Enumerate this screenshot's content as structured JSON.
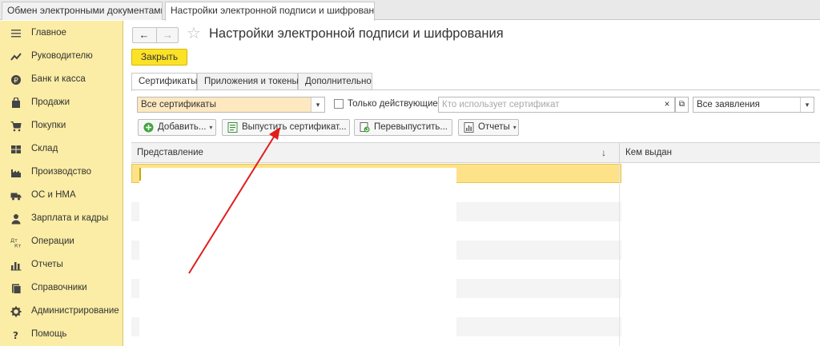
{
  "tabs": [
    {
      "label": "Обмен электронными документами",
      "close": "×"
    },
    {
      "label": "Настройки электронной подписи и шифрования",
      "close": "×"
    }
  ],
  "sidebar": {
    "items": [
      {
        "label": "Главное",
        "icon": "menu-icon"
      },
      {
        "label": "Руководителю",
        "icon": "trend-icon"
      },
      {
        "label": "Банк и касса",
        "icon": "ruble-coin-icon"
      },
      {
        "label": "Продажи",
        "icon": "bag-icon"
      },
      {
        "label": "Покупки",
        "icon": "cart-icon"
      },
      {
        "label": "Склад",
        "icon": "warehouse-icon"
      },
      {
        "label": "Производство",
        "icon": "factory-icon"
      },
      {
        "label": "ОС и НМА",
        "icon": "truck-icon"
      },
      {
        "label": "Зарплата и кадры",
        "icon": "person-icon"
      },
      {
        "label": "Операции",
        "icon": "debit-credit-icon"
      },
      {
        "label": "Отчеты",
        "icon": "bar-chart-icon"
      },
      {
        "label": "Справочники",
        "icon": "books-icon"
      },
      {
        "label": "Администрирование",
        "icon": "gear-icon"
      },
      {
        "label": "Помощь",
        "icon": "question-icon"
      }
    ]
  },
  "header": {
    "back": "←",
    "forward": "→",
    "star": "☆",
    "title": "Настройки электронной подписи и шифрования"
  },
  "toolbar": {
    "close_label": "Закрыть"
  },
  "form_tabs": [
    {
      "label": "Сертификаты"
    },
    {
      "label": "Приложения и токены"
    },
    {
      "label": "Дополнительно"
    }
  ],
  "filters": {
    "scope_value": "Все сертификаты",
    "only_active_label": "Только действующие",
    "user_placeholder": "Кто использует сертификат",
    "requests_value": "Все заявления",
    "dropdown_glyph": "▾",
    "clear_glyph": "×",
    "open_glyph": "⧉"
  },
  "actions": {
    "add_label": "Добавить...",
    "issue_label": "Выпустить сертификат...",
    "reissue_label": "Перевыпустить...",
    "reports_label": "Отчеты"
  },
  "table": {
    "columns": [
      "Представление",
      "Кем выдан"
    ],
    "sort_glyph": "↓"
  },
  "colors": {
    "sidebar_bg": "#fbeda5",
    "accent_yellow": "#fce226",
    "arrow": "#e11d1d"
  }
}
